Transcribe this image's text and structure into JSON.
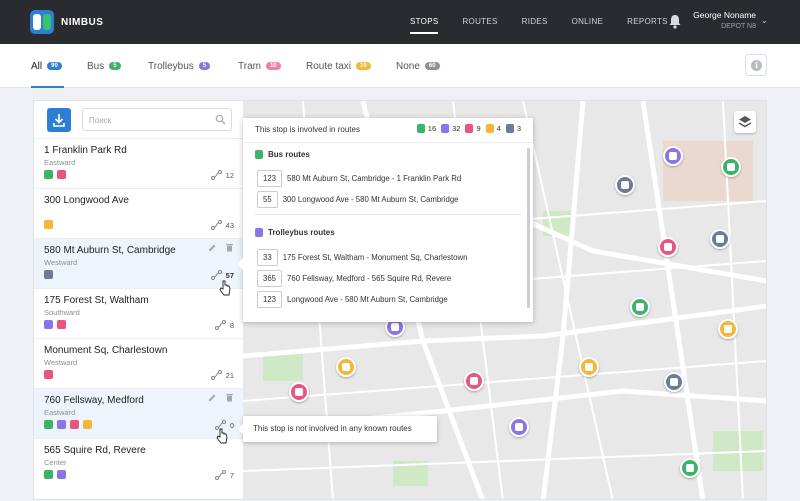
{
  "app": {
    "name": "NIMBUS"
  },
  "nav": {
    "items": [
      "STOPS",
      "ROUTES",
      "RIDES",
      "ONLINE",
      "REPORTS"
    ],
    "active": "STOPS"
  },
  "user": {
    "name": "George Noname",
    "depot": "DEPOT N8"
  },
  "filters": [
    {
      "label": "All",
      "count": "90",
      "color": "#2d7fd3"
    },
    {
      "label": "Bus",
      "count": "5",
      "color": "#3db36a"
    },
    {
      "label": "Trolleybus",
      "count": "5",
      "color": "#8b74e6"
    },
    {
      "label": "Tram",
      "count": "10",
      "color": "#ef7fa8"
    },
    {
      "label": "Route taxi",
      "count": "10",
      "color": "#f4b73a"
    },
    {
      "label": "None",
      "count": "60",
      "color": "#8d9198"
    }
  ],
  "search": {
    "placeholder": "Поиск"
  },
  "stops": [
    {
      "name": "1 Franklin Park Rd",
      "direction": "Eastward",
      "count": "12"
    },
    {
      "name": "300 Longwood Ave",
      "direction": "",
      "count": "43"
    },
    {
      "name": "580 Mt Auburn St, Cambridge",
      "direction": "Westward",
      "count": "57"
    },
    {
      "name": "175 Forest St, Waltham",
      "direction": "Southward",
      "count": "8"
    },
    {
      "name": "Monument Sq, Charlestown",
      "direction": "Westward",
      "count": "21"
    },
    {
      "name": "760 Fellsway, Medford",
      "direction": "Eastward",
      "count": "0"
    },
    {
      "name": "565 Squire Rd, Revere",
      "direction": "Center",
      "count": "7"
    }
  ],
  "popup": {
    "title": "This stop is involved in routes",
    "counts": [
      "16",
      "32",
      "9",
      "4",
      "3"
    ],
    "bus_title": "Bus routes",
    "bus_routes": [
      {
        "num": "123",
        "name": "580 Mt Auburn St, Cambridge - 1 Franklin Park Rd"
      },
      {
        "num": "55",
        "name": "300 Longwood Ave - 580 Mt Auburn St, Cambridge"
      }
    ],
    "trolley_title": "Trolleybus routes",
    "trolley_routes": [
      {
        "num": "33",
        "name": "175 Forest St, Waltham - Monument Sq, Charlestown"
      },
      {
        "num": "365",
        "name": "760 Fellsway, Medford - 565 Squire Rd, Revere"
      },
      {
        "num": "123",
        "name": "Longwood Ave - 580 Mt Auburn St, Cambridge"
      }
    ]
  },
  "tooltip": {
    "text": "This stop is not involved in any known routes"
  },
  "colors": {
    "bus": "#3db36a",
    "trolley": "#8b74e6",
    "tram": "#e8557f",
    "taxi": "#f4b73a",
    "none": "#6f7a99",
    "accent": "#2d7fd3"
  }
}
